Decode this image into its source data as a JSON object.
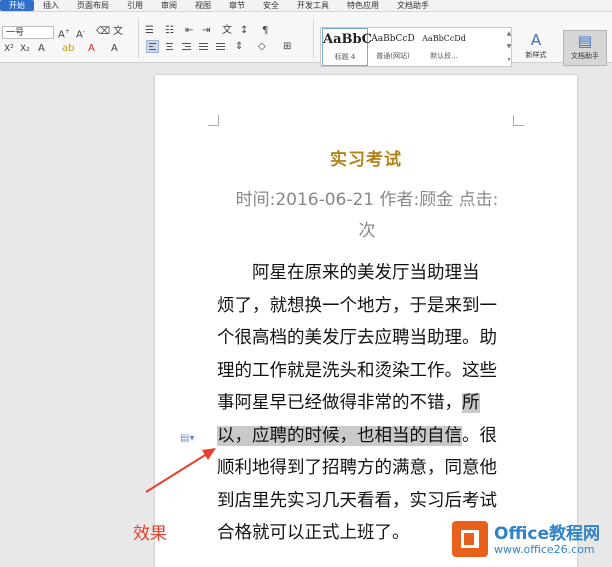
{
  "ribbon": {
    "tabs": [
      {
        "label": "开始",
        "active": true
      },
      {
        "label": "插入"
      },
      {
        "label": "页面布局"
      },
      {
        "label": "引用"
      },
      {
        "label": "审阅"
      },
      {
        "label": "视图"
      },
      {
        "label": "章节"
      },
      {
        "label": "安全"
      },
      {
        "label": "开发工具"
      },
      {
        "label": "特色应用"
      },
      {
        "label": "文档助手"
      }
    ]
  },
  "toolbar": {
    "font_size_value": "一号",
    "style_gallery": [
      {
        "sample": "AaBbC",
        "name": "标题 4"
      },
      {
        "sample": "AaBbCcD",
        "name": "普通(网站)"
      },
      {
        "sample": "AaBbCcDd",
        "name": "默认段..."
      }
    ],
    "new_style_label": "新样式",
    "doc_assistant_label": "文档助手"
  },
  "document": {
    "title": "实习考试",
    "meta_lines": [
      "时间:2016-06-21  作者:顾金  点击:",
      "次"
    ],
    "body_lines": [
      {
        "pre": "　　阿星在原来的美发厅当助理当",
        "hl": "",
        "post": ""
      },
      {
        "pre": "烦了，就想换一个地方，于是来到一",
        "hl": "",
        "post": ""
      },
      {
        "pre": "个很高档的美发厅去应聘当助理。助",
        "hl": "",
        "post": ""
      },
      {
        "pre": "理的工作就是洗头和烫染工作。这些",
        "hl": "",
        "post": ""
      },
      {
        "pre": "事阿星早已经做得非常的不错，",
        "hl": "所",
        "post": ""
      },
      {
        "pre": "",
        "hl": "以，应聘的时候，也相当的自信",
        "post": "。很"
      },
      {
        "pre": "顺利地得到了招聘方的满意，同意他",
        "hl": "",
        "post": ""
      },
      {
        "pre": "到店里先实习几天看看，实习后考试",
        "hl": "",
        "post": ""
      },
      {
        "pre": "合格就可以正式上班了。",
        "hl": "",
        "post": ""
      }
    ]
  },
  "annotation": {
    "caption": "效果",
    "caption_color": "#e6412c"
  },
  "watermark": {
    "title": "Office教程网",
    "url": "www.office26.com",
    "logo_color": "#e8601c",
    "text_color": "#2f83c9"
  },
  "colors": {
    "title": "#b5831b",
    "active_tab": "#2f6fcb",
    "highlight": "#c9c9c9"
  }
}
